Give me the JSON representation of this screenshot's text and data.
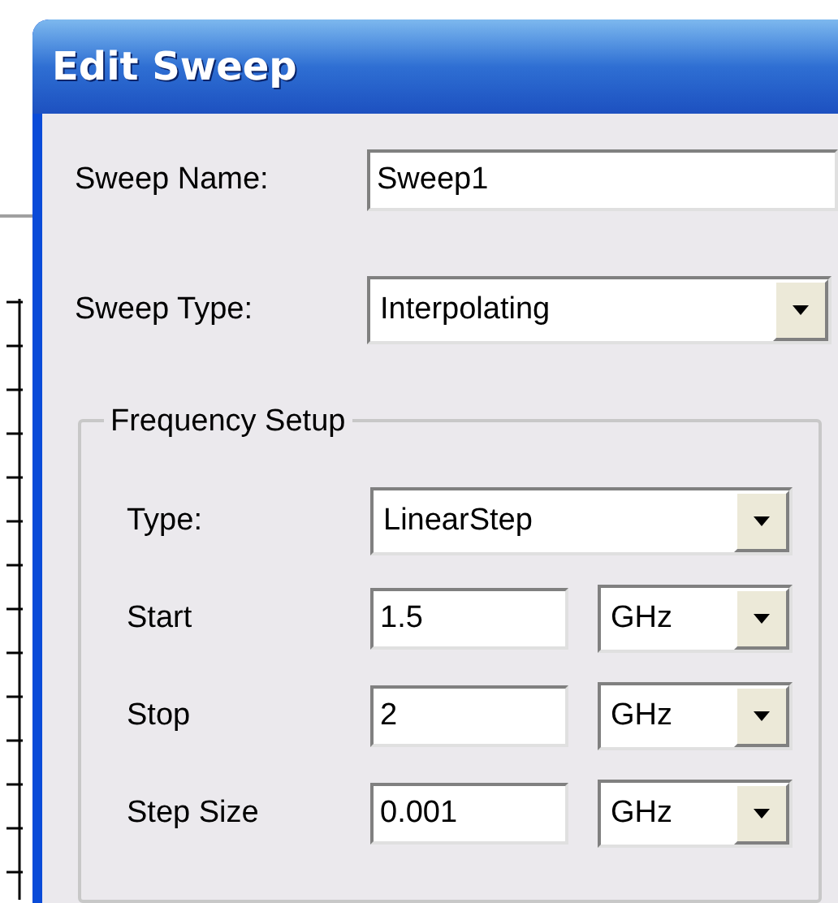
{
  "window": {
    "title": "Edit Sweep"
  },
  "sweep_name": {
    "label": "Sweep Name:",
    "value": "Sweep1"
  },
  "sweep_type": {
    "label": "Sweep Type:",
    "value": "Interpolating"
  },
  "frequency_setup": {
    "title": "Frequency Setup",
    "type": {
      "label": "Type:",
      "value": "LinearStep"
    },
    "rows": [
      {
        "label": "Start",
        "value": "1.5",
        "unit": "GHz"
      },
      {
        "label": "Stop",
        "value": "2",
        "unit": "GHz"
      },
      {
        "label": "Step Size",
        "value": "0.001",
        "unit": "GHz"
      }
    ]
  }
}
